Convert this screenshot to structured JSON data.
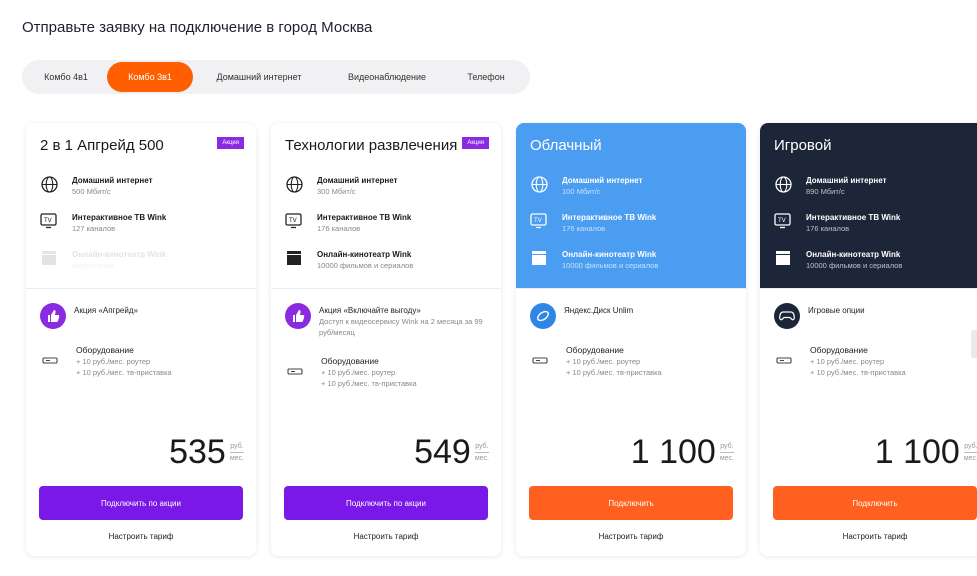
{
  "page_title": "Отправьте заявку на подключение в город Москва",
  "tabs": [
    {
      "label": "Комбо 4в1",
      "active": false
    },
    {
      "label": "Комбо 3в1",
      "active": true
    },
    {
      "label": "Домашний интернет",
      "active": false
    },
    {
      "label": "Видеонаблюдение",
      "active": false
    },
    {
      "label": "Телефон",
      "active": false
    }
  ],
  "colors": {
    "accent": "#ff5f00",
    "purple": "#7a18e8",
    "blue_card": "#4a9df0",
    "dark_card": "#1c2638"
  },
  "cards": [
    {
      "title": "2 в 1 Апгрейд 500",
      "badge": "Акция",
      "features": [
        {
          "icon": "globe-icon",
          "name": "Домашний интернет",
          "sub": "500 Мбит/с"
        },
        {
          "icon": "tv-icon",
          "name": "Интерактивное ТВ Wink",
          "sub": "127 каналов"
        },
        {
          "icon": "clapper-icon",
          "name": "Онлайн-кинотеатр Wink",
          "sub": "Недоступно"
        }
      ],
      "extra": {
        "icon": "thumbs-up-icon",
        "name": "Акция «Апгрейд»",
        "sub": ""
      },
      "equipment": {
        "name": "Оборудование",
        "line1": "+ 10 руб./мес. роутер",
        "line2": "+ 10 руб./мес. тв-приставка"
      },
      "price": "535",
      "unit_top": "руб.",
      "unit_bottom": "мес.",
      "button": "Подключить по акции",
      "configure": "Настроить тариф"
    },
    {
      "title": "Технологии развлечения",
      "badge": "Акция",
      "features": [
        {
          "icon": "globe-icon",
          "name": "Домашний интернет",
          "sub": "300 Мбит/с"
        },
        {
          "icon": "tv-icon",
          "name": "Интерактивное ТВ Wink",
          "sub": "176 каналов"
        },
        {
          "icon": "clapper-icon",
          "name": "Онлайн-кинотеатр Wink",
          "sub": "10000 фильмов и сериалов"
        }
      ],
      "extra": {
        "icon": "thumbs-up-icon",
        "name": "Акция «Включайте выгоду»",
        "sub": "Доступ к видеосервису Wink на 2 месяца за 99 руб/месяц"
      },
      "equipment": {
        "name": "Оборудование",
        "line1": "+ 10 руб./мес. роутер",
        "line2": "+ 10 руб./мес. тв-приставка"
      },
      "price": "549",
      "unit_top": "руб.",
      "unit_bottom": "мес.",
      "button": "Подключить по акции",
      "configure": "Настроить тариф"
    },
    {
      "title": "Облачный",
      "badge": "",
      "features": [
        {
          "icon": "globe-icon",
          "name": "Домашний интернет",
          "sub": "100 Мбит/с"
        },
        {
          "icon": "tv-icon",
          "name": "Интерактивное ТВ Wink",
          "sub": "176 каналов"
        },
        {
          "icon": "clapper-icon",
          "name": "Онлайн-кинотеатр Wink",
          "sub": "10000 фильмов и сериалов"
        }
      ],
      "extra": {
        "icon": "cloud-disk-icon",
        "name": "Яндекс.Диск Unlim",
        "sub": ""
      },
      "equipment": {
        "name": "Оборудование",
        "line1": "+ 10 руб./мес. роутер",
        "line2": "+ 10 руб./мес. тв-приставка"
      },
      "price": "1 100",
      "unit_top": "руб.",
      "unit_bottom": "мес.",
      "button": "Подключить",
      "configure": "Настроить тариф"
    },
    {
      "title": "Игровой",
      "badge": "",
      "features": [
        {
          "icon": "globe-icon",
          "name": "Домашний интернет",
          "sub": "890 Мбит/с"
        },
        {
          "icon": "tv-icon",
          "name": "Интерактивное ТВ Wink",
          "sub": "176 каналов"
        },
        {
          "icon": "clapper-icon",
          "name": "Онлайн-кинотеатр Wink",
          "sub": "10000 фильмов и сериалов"
        }
      ],
      "extra": {
        "icon": "gamepad-icon",
        "name": "Игровые опции",
        "sub": ""
      },
      "equipment": {
        "name": "Оборудование",
        "line1": "+ 10 руб./мес. роутер",
        "line2": "+ 10 руб./мес. тв-приставка"
      },
      "price": "1 100",
      "unit_top": "руб.",
      "unit_bottom": "мес.",
      "button": "Подключить",
      "configure": "Настроить тариф"
    }
  ]
}
